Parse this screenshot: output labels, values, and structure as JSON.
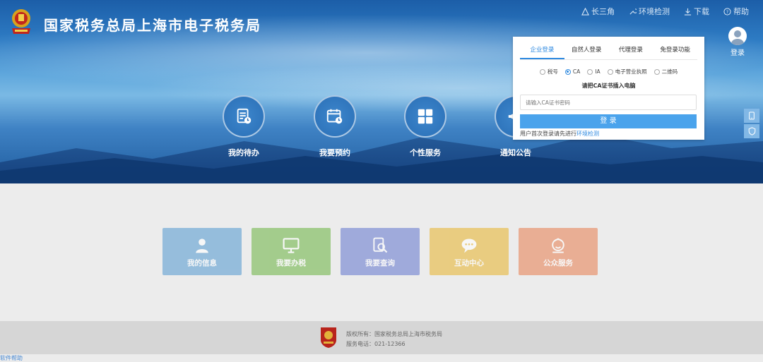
{
  "header": {
    "title": "国家税务总局上海市电子税务局",
    "nav": [
      {
        "label": "长三角",
        "icon": "triangle-icon"
      },
      {
        "label": "环境检测",
        "icon": "wrench-icon"
      },
      {
        "label": "下载",
        "icon": "download-icon"
      },
      {
        "label": "帮助",
        "icon": "help-icon"
      }
    ],
    "user_label": "登录"
  },
  "quick": [
    {
      "label": "我的待办",
      "icon": "todo-doc-icon"
    },
    {
      "label": "我要预约",
      "icon": "calendar-clock-icon"
    },
    {
      "label": "个性服务",
      "icon": "grid-icon"
    },
    {
      "label": "通知公告",
      "icon": "notice-icon"
    }
  ],
  "login": {
    "tabs": [
      "企业登录",
      "自然人登录",
      "代理登录",
      "免登录功能"
    ],
    "active_tab": 0,
    "radios": [
      "税号",
      "CA",
      "IA",
      "电子营业执照",
      "二维码"
    ],
    "selected_radio": 1,
    "hint": "请把CA证书插入电脑",
    "password_placeholder": "请输入CA证书密码",
    "button": "登 录",
    "first_time_prefix": "用户首次登录请先进行",
    "first_time_link": "环境检测"
  },
  "tiles": [
    {
      "label": "我的信息",
      "color": "#5d9fd2",
      "icon": "person-icon"
    },
    {
      "label": "我要办税",
      "color": "#74b84e",
      "icon": "monitor-icon"
    },
    {
      "label": "我要查询",
      "color": "#6c7fd1",
      "icon": "search-doc-icon"
    },
    {
      "label": "互动中心",
      "color": "#e8b73a",
      "icon": "chat-icon"
    },
    {
      "label": "公众服务",
      "color": "#e8855a",
      "icon": "service-icon"
    }
  ],
  "footer": {
    "copyright": "版权所有：国家税务总局上海市税务局",
    "phone": "服务电话：021-12366"
  },
  "bottom_link": "软件帮助"
}
